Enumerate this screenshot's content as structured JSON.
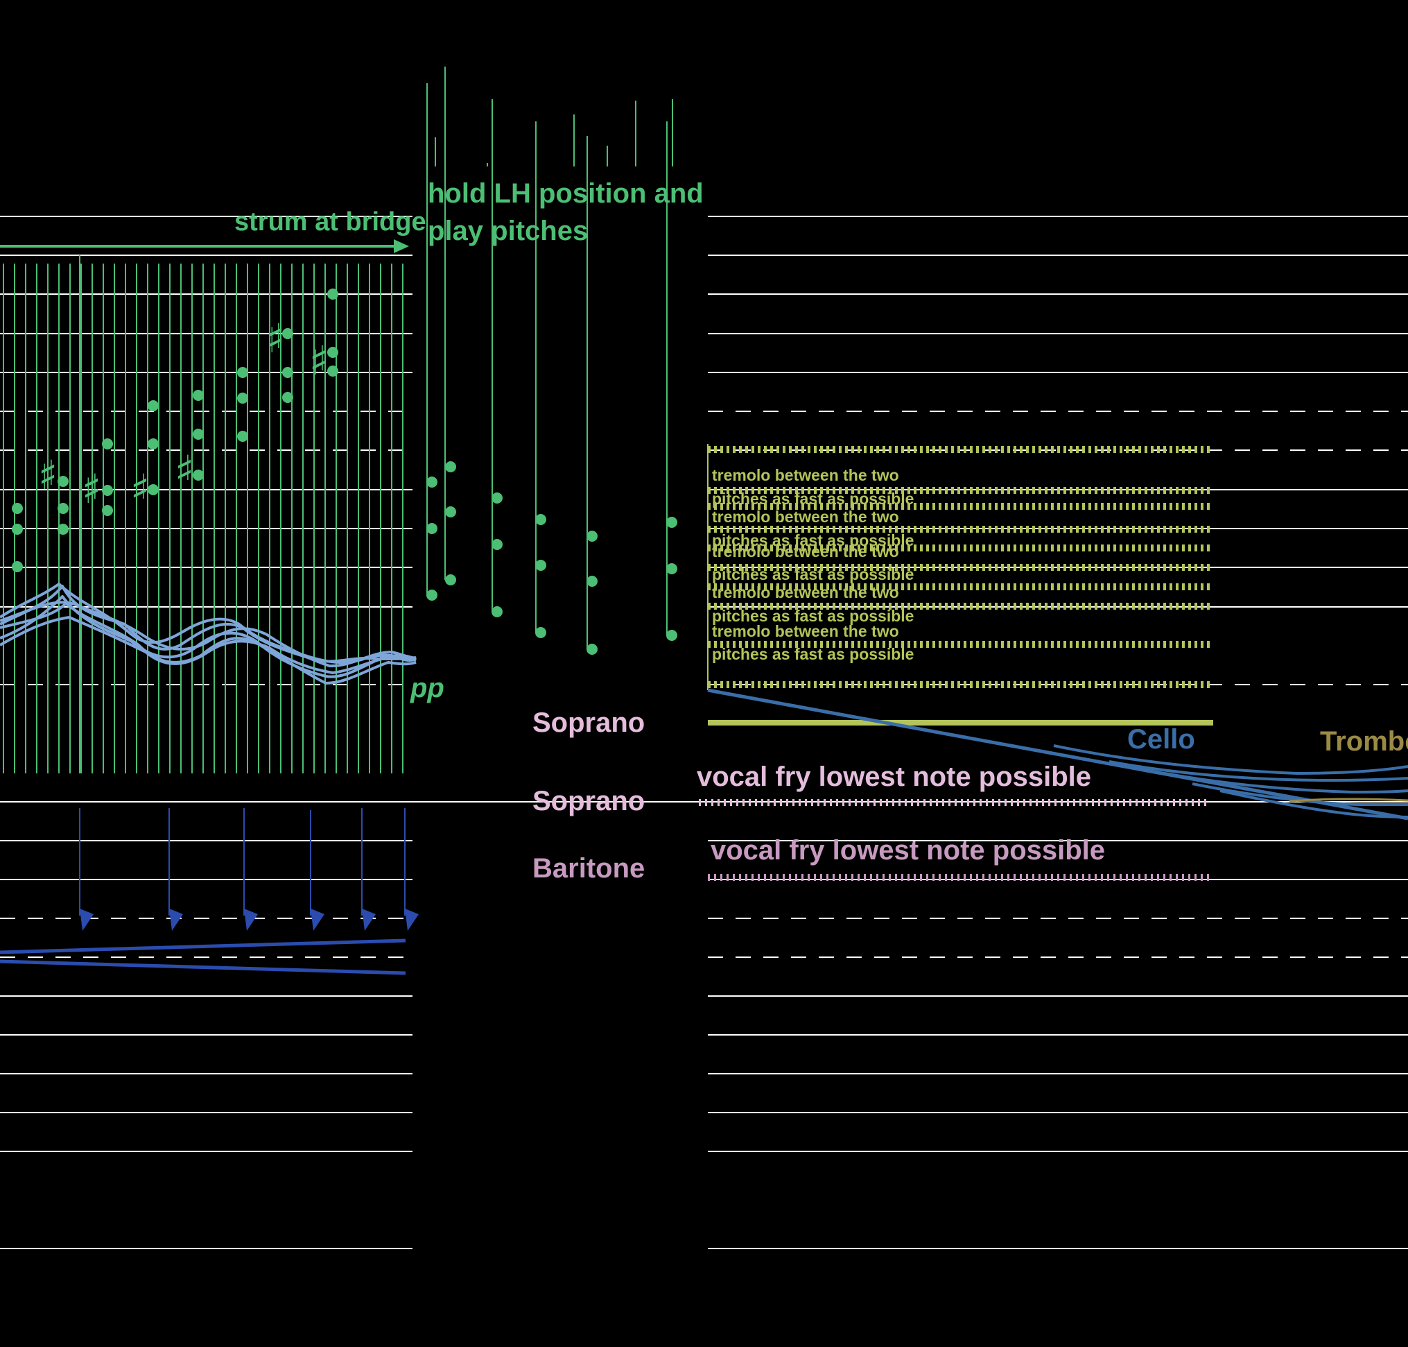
{
  "colors": {
    "background": "#000000",
    "staff": "#ffffff",
    "guitar": "#4cbf74",
    "contour": "#7ea6d8",
    "tremolo": "#b4c45a",
    "soprano": "#e4bcdc",
    "baritone": "#c79ac0",
    "cello": "#3a6ea8",
    "trombone": "#9b8a45",
    "percussion": "#2b4cae"
  },
  "annotations": {
    "strum": "strum at bridge",
    "hold_line1": "hold LH position and",
    "hold_line2": "play pitches",
    "dynamic": "pp",
    "tremolo_line1": "tremolo between the two",
    "tremolo_line2": "pitches as fast as possible",
    "vocal_fry": "vocal fry lowest note possible"
  },
  "instruments": {
    "soprano": "Soprano",
    "baritone": "Baritone",
    "cello": "Cello",
    "trombone": "Trombo"
  },
  "icons": {
    "sharp": "sharp-icon",
    "arrow": "right-arrow-icon",
    "down_arrow": "down-arrow-icon"
  },
  "glyphs": {
    "sharp": "♯"
  }
}
